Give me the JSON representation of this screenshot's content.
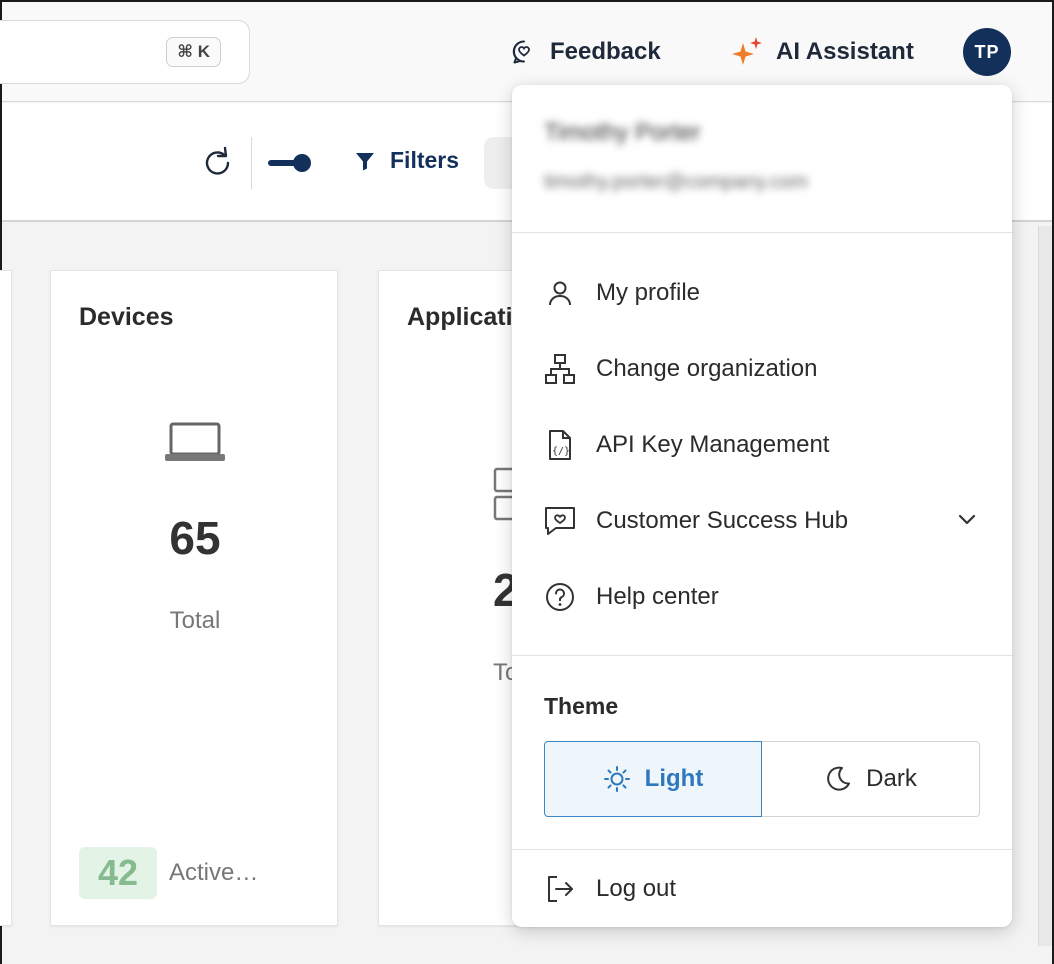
{
  "topbar": {
    "search_shortcut": "⌘ K",
    "feedback_label": "Feedback",
    "ai_assistant_label": "AI Assistant",
    "avatar_initials": "TP"
  },
  "toolbar": {
    "filters_label": "Filters"
  },
  "cards": [
    {
      "title": "Devices",
      "icon": "laptop-icon",
      "total_value": "65",
      "total_label": "Total",
      "active_value": "42",
      "active_label": "Active…"
    },
    {
      "title": "Applicati",
      "icon": "applications-icon",
      "total_value": "2",
      "total_label": "To"
    }
  ],
  "user_menu": {
    "user_name": "Timothy Porter",
    "user_email": "timothy.porter@company.com",
    "items": [
      {
        "label": "My profile",
        "icon": "user-icon"
      },
      {
        "label": "Change organization",
        "icon": "org-chart-icon"
      },
      {
        "label": "API Key Management",
        "icon": "code-file-icon"
      },
      {
        "label": "Customer Success Hub",
        "icon": "chat-heart-icon"
      },
      {
        "label": "Help center",
        "icon": "help-circle-icon"
      }
    ],
    "theme": {
      "label": "Theme",
      "options": [
        "Light",
        "Dark"
      ],
      "selected": "Light"
    },
    "logout_label": "Log out"
  },
  "colors": {
    "brand_navy": "#13305a",
    "ai_orange": "#f07b2a",
    "ai_red": "#e8412c",
    "active_green_bg": "#e3f4e6",
    "active_green_text": "#86bb8f",
    "theme_selected_border": "#3d87c7",
    "theme_selected_text": "#2f78bb"
  }
}
